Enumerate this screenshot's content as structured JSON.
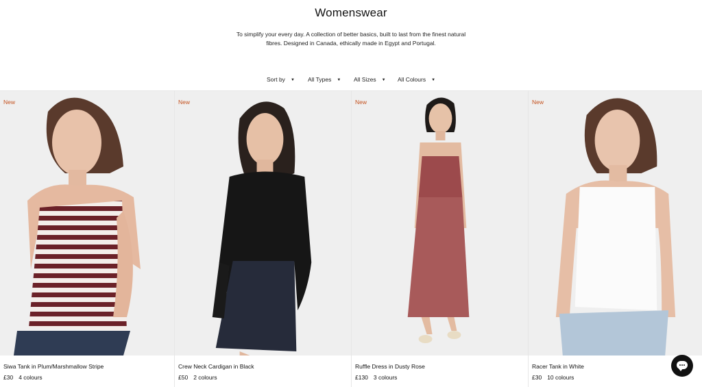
{
  "page": {
    "title": "Womenswear",
    "description": "To simplify your every day. A collection of better basics, built to last from the finest natural fibres. Designed in Canada, ethically made in Egypt and Portugal."
  },
  "filters": [
    {
      "label": "Sort by"
    },
    {
      "label": "All Types"
    },
    {
      "label": "All Sizes"
    },
    {
      "label": "All Colours"
    }
  ],
  "products": [
    {
      "badge": "New",
      "name": "Siwa Tank in Plum/Marshmallow Stripe",
      "price": "£30",
      "colours": "4 colours"
    },
    {
      "badge": "New",
      "name": "Crew Neck Cardigan in Black",
      "price": "£50",
      "colours": "2 colours"
    },
    {
      "badge": "New",
      "name": "Ruffle Dress in Dusty Rose",
      "price": "£130",
      "colours": "3 colours"
    },
    {
      "badge": "New",
      "name": "Racer Tank in White",
      "price": "£30",
      "colours": "10 colours"
    }
  ],
  "colors": {
    "badge": "#c4511e",
    "background": "#ffffff",
    "photo_background": "#efefef",
    "chat_button": "#111111"
  },
  "icons": {
    "filter_caret": "caret-down-icon",
    "chat": "chat-bubble-icon"
  }
}
